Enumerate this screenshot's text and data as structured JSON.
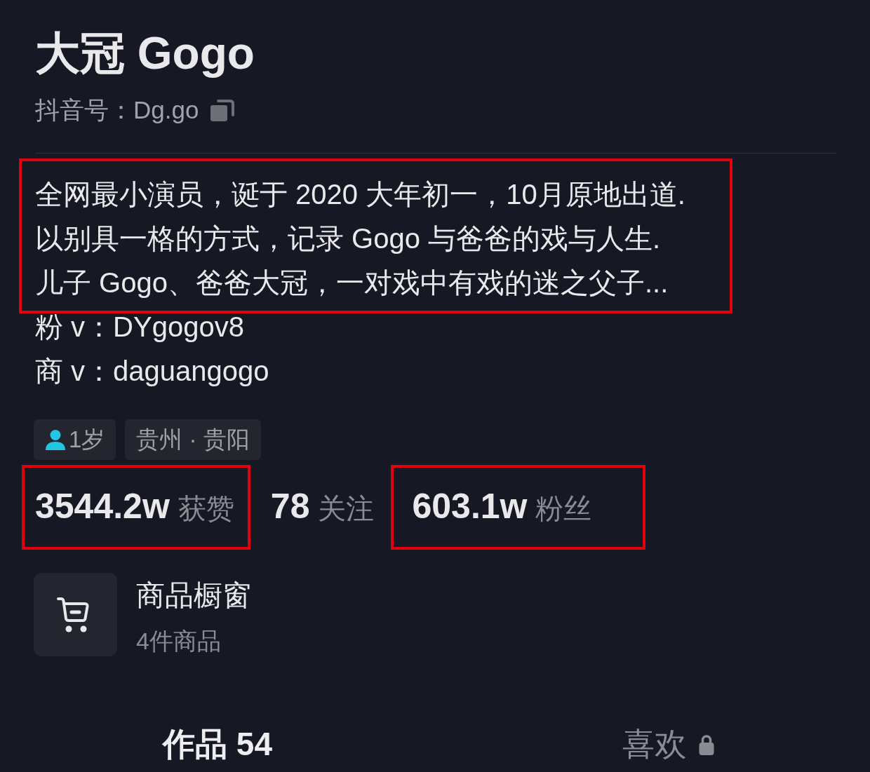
{
  "profile": {
    "name": "大冠 Gogo",
    "account_id": "抖音号：Dg.go"
  },
  "bio": {
    "lines": [
      "全网最小演员，诞于 2020 大年初一，10月原地出道.",
      "以别具一格的方式，记录 Gogo 与爸爸的戏与人生.",
      "儿子 Gogo、爸爸大冠，一对戏中有戏的迷之父子..."
    ],
    "highlighted": true
  },
  "contacts": [
    "粉 v：DYgogov8",
    "商 v：daguangogo"
  ],
  "tags": [
    {
      "kind": "age",
      "text": "1岁"
    },
    {
      "kind": "location",
      "text": "贵州 · 贵阳"
    }
  ],
  "stats": [
    {
      "count": "3544.2w",
      "label": "获赞",
      "highlighted": true
    },
    {
      "count": "78",
      "label": "关注",
      "highlighted": false
    },
    {
      "count": "603.1w",
      "label": "粉丝",
      "highlighted": true
    }
  ],
  "shop": {
    "title": "商品橱窗",
    "subtitle": "4件商品"
  },
  "tabs": [
    {
      "label": "作品 54",
      "selected": true,
      "locked": false
    },
    {
      "label": "喜欢",
      "selected": false,
      "locked": true
    }
  ]
}
